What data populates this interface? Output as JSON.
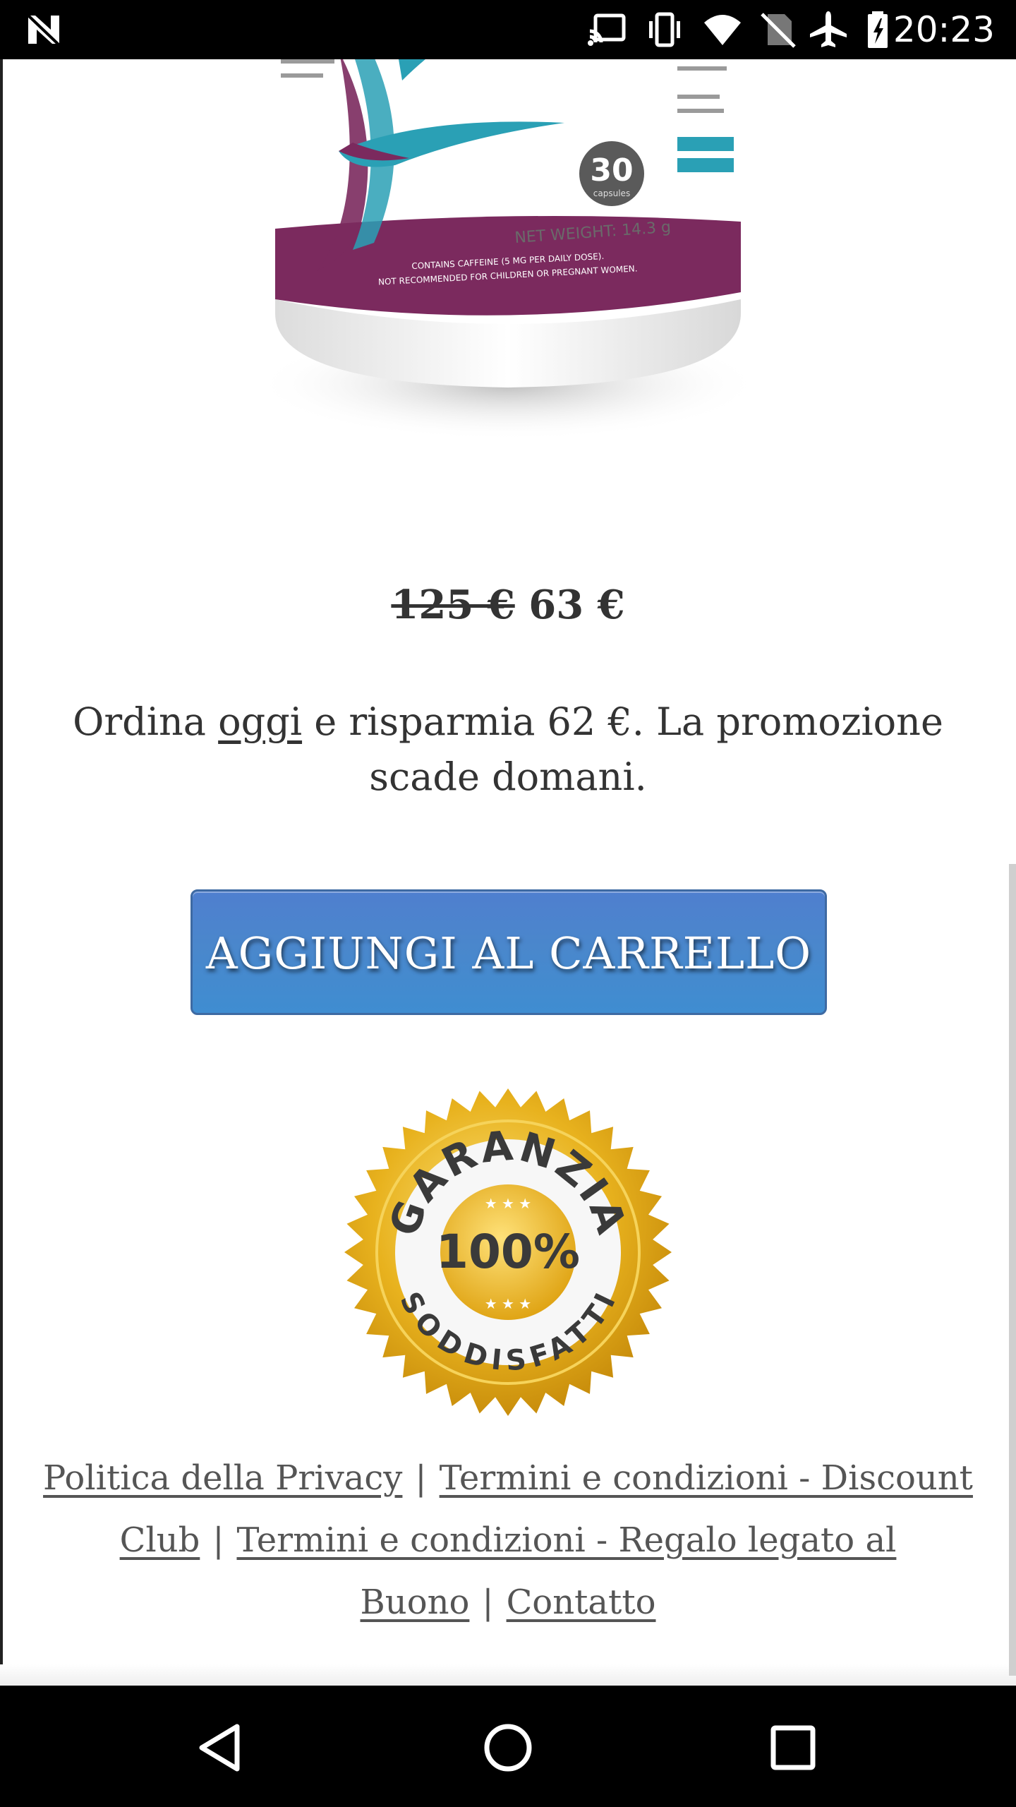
{
  "status_bar": {
    "time": "20:23",
    "icons": [
      "n-logo-icon",
      "cast-icon",
      "vibrate-icon",
      "wifi-icon",
      "no-sim-icon",
      "airplane-icon",
      "battery-icon"
    ]
  },
  "product": {
    "image_icon": "product-bottle-image",
    "bottle_capsules_number": "30",
    "bottle_capsules_label": "capsules",
    "bottle_net_weight": "NET WEIGHT: 14.3 g",
    "bottle_warning_1": "CONTAINS CAFFEINE (5 MG PER DAILY DOSE).",
    "bottle_warning_2": "NOT RECOMMENDED FOR CHILDREN OR PREGNANT WOMEN."
  },
  "price": {
    "old": "125 €",
    "new": "63 €"
  },
  "promo": {
    "before": "Ordina ",
    "highlight": "oggi",
    "after": " e risparmia 62 €. La promozione scade domani."
  },
  "cart_button": {
    "label": "AGGIUNGI AL CARRELLO"
  },
  "seal": {
    "top_text": "GARANZIA",
    "percent": "100%",
    "bottom_text": "SODDISFATTI"
  },
  "footer": {
    "link_privacy": "Politica della Privacy",
    "link_terms_discount": "Termini e condizioni - Discount Club",
    "link_terms_gift": "Termini e condizioni - Regalo legato al Buono",
    "link_contact": "Contatto",
    "separator": "|"
  },
  "nav_bar": {
    "icons": [
      "back-icon",
      "home-icon",
      "recents-icon"
    ]
  },
  "colors": {
    "button_blue": "#4a87cc",
    "bottle_purple": "#7b2a5e",
    "bottle_teal": "#2aa0b5",
    "seal_gold": "#e8b21e"
  }
}
